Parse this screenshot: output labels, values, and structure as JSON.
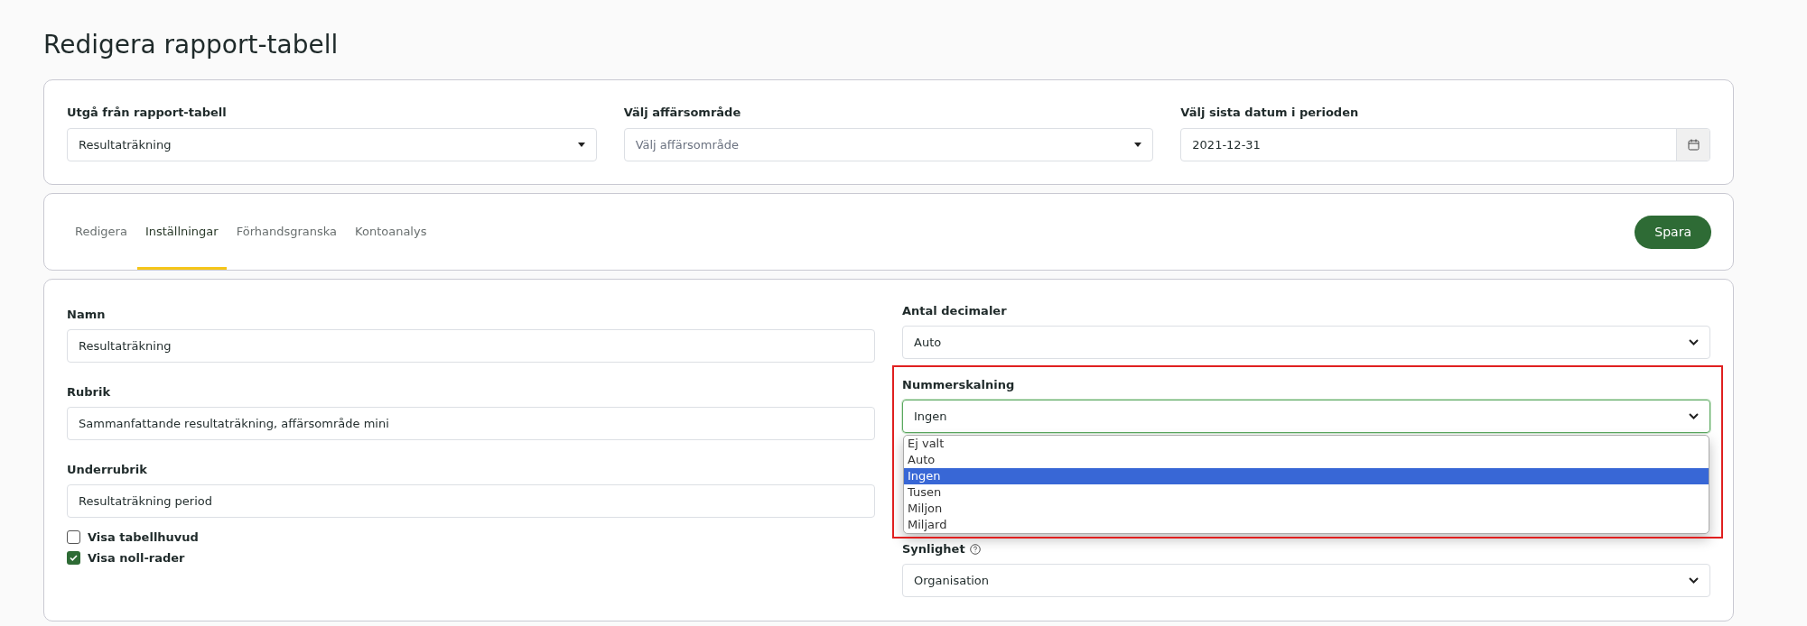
{
  "title": "Redigera rapport-tabell",
  "top_fields": [
    {
      "label": "Utgå från rapport-tabell",
      "kind": "select",
      "value": "Resultaträkning"
    },
    {
      "label": "Välj affärsområde",
      "kind": "select",
      "placeholder": "Välj affärsområde"
    },
    {
      "label": "Välj sista datum i perioden",
      "kind": "date",
      "value": "2021-12-31"
    }
  ],
  "tabs": [
    {
      "label": "Redigera",
      "selected": false
    },
    {
      "label": "Inställningar",
      "selected": true
    },
    {
      "label": "Förhandsgranska",
      "selected": false
    },
    {
      "label": "Kontoanalys",
      "selected": false
    }
  ],
  "save_button": "Spara",
  "left_fields": [
    {
      "label": "Namn",
      "value": "Resultaträkning"
    },
    {
      "label": "Rubrik",
      "value": "Sammanfattande resultaträkning, affärsområde mini"
    },
    {
      "label": "Underrubrik",
      "value": "Resultaträkning period"
    }
  ],
  "checkboxes": [
    {
      "label": "Visa tabellhuvud",
      "checked": false
    },
    {
      "label": "Visa noll-rader",
      "checked": true
    }
  ],
  "right_fields": [
    {
      "label": "Antal decimaler",
      "kind": "select",
      "value": "Auto",
      "highlighted": false,
      "expanded": false
    },
    {
      "label": "Nummerskalning",
      "kind": "select",
      "value": "Ingen",
      "highlighted": true,
      "expanded": true,
      "options": [
        {
          "label": "Ej valt",
          "selected": false
        },
        {
          "label": "Auto",
          "selected": false
        },
        {
          "label": "Ingen",
          "selected": true
        },
        {
          "label": "Tusen",
          "selected": false
        },
        {
          "label": "Miljon",
          "selected": false
        },
        {
          "label": "Miljard",
          "selected": false
        }
      ]
    },
    {
      "label": "Synlighet",
      "kind": "select_with_help",
      "value": "Organisation",
      "highlighted": false,
      "expanded": false
    }
  ]
}
